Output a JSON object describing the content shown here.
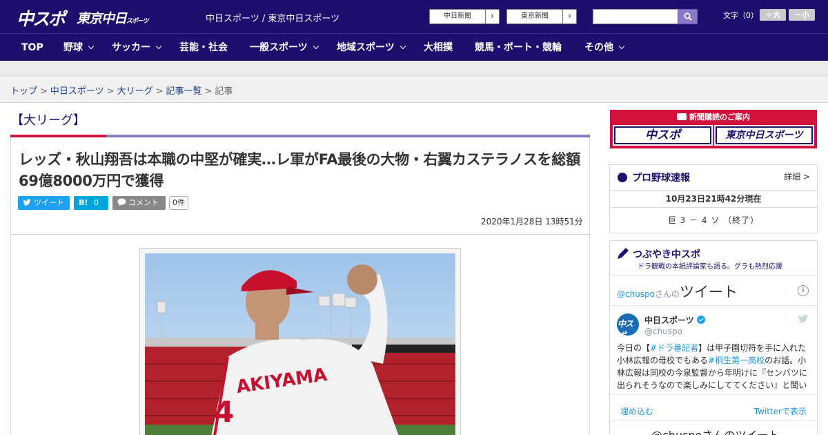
{
  "header": {
    "logo_chuspo": "中スポ",
    "logo_tokyo": "東京中日",
    "logo_tokyo_suffix": "スポーツ",
    "site_name": "中日スポーツ / 東京中日スポーツ",
    "paper_links": [
      "中日新聞",
      "東京新聞"
    ],
    "search_placeholder": "",
    "font_size_label": "文字（0）",
    "font_larger": "＋大",
    "font_smaller": "－小"
  },
  "nav": {
    "items": [
      {
        "label": "TOP",
        "dropdown": false
      },
      {
        "label": "野球",
        "dropdown": true
      },
      {
        "label": "サッカー",
        "dropdown": true
      },
      {
        "label": "芸能・社会",
        "dropdown": false
      },
      {
        "label": "一般スポーツ",
        "dropdown": true
      },
      {
        "label": "地域スポーツ",
        "dropdown": true
      },
      {
        "label": "大相撲",
        "dropdown": false
      },
      {
        "label": "競馬・ボート・競輪",
        "dropdown": false
      },
      {
        "label": "その他",
        "dropdown": true
      }
    ]
  },
  "breadcrumb": {
    "links": [
      "トップ",
      "中日スポーツ",
      "大リーグ",
      "記事一覧"
    ],
    "current": "記事"
  },
  "article": {
    "category": "【大リーグ】",
    "headline": "レッズ・秋山翔吾は本職の中堅が確実…レ軍がFA最後の大物・右翼カステラノスを総額69億8000万円で獲得",
    "tweet_label": "ツイート",
    "hatena_count": "0",
    "comment_label": "コメント",
    "comment_count": "0件",
    "published": "2020年1月28日 13時51分",
    "photo_jersey": "AKIYAMA",
    "photo_number": "4"
  },
  "sidebar": {
    "subscribe_title": "新聞購読のご案内",
    "subscribe_logos": [
      "中スポ",
      "東京中日スポーツ"
    ],
    "baseball": {
      "title": "プロ野球速報",
      "detail": "詳細 >",
      "time": "10月23日21時42分現在",
      "game": "巨 3 － 4 ソ （終了）"
    },
    "tweets": {
      "title": "つぶやき中スポ",
      "subtitle": "ドラ観戦の本紙評論家も語る。グラも熱烈応援",
      "handle_prefix": "@chuspo",
      "san": "さんの",
      "head_big": "ツイート",
      "account_name": "中日スポーツ",
      "account_handle": "@chuspo",
      "avatar_text": "中スポ",
      "text_1": "今日の【",
      "hashtag_1": "#ドラ番記者",
      "text_2": "】は甲子園切符を手に入れた小林広報の母校でもある",
      "hashtag_2": "#桐生第一高校",
      "text_3": "のお話。小林広報は同校の今泉監督から年明けに『センバツに出られそうなので楽しみにしててください』と聞いていたそうです",
      "embed": "埋め込む",
      "view_on_twitter": "Twitterで表示",
      "footer": "@chuspoさんのツイート"
    }
  },
  "colors": {
    "brand_navy": "#1d0f6e",
    "accent_red": "#d3113d",
    "link_blue": "#1b3f8f"
  }
}
